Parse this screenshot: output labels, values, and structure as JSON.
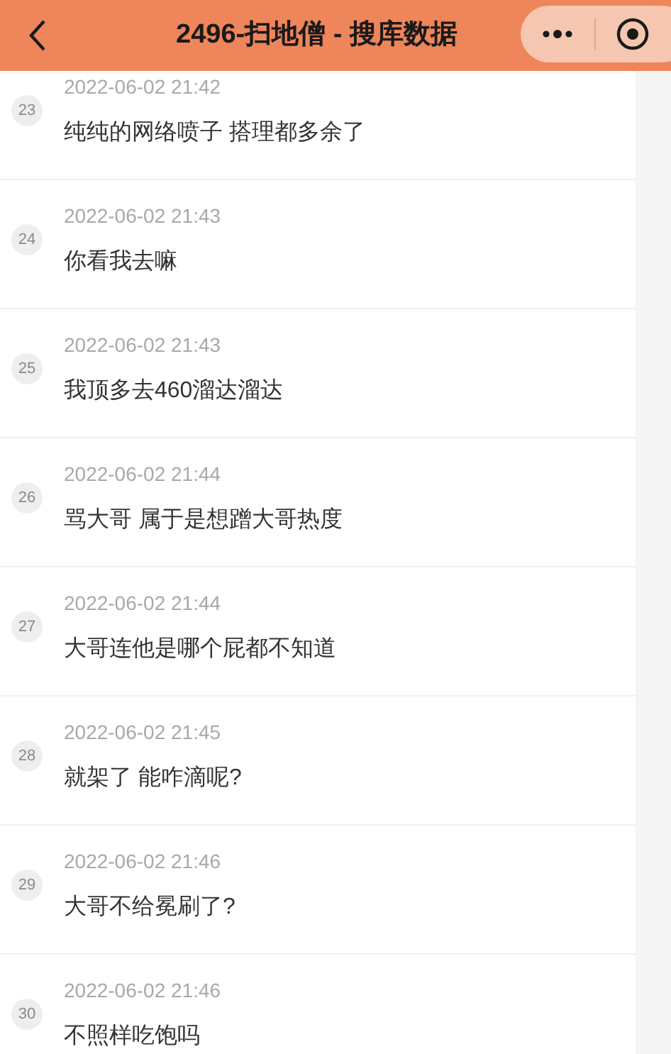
{
  "header": {
    "title": "2496-扫地僧 - 搜库数据"
  },
  "comments": [
    {
      "index": "23",
      "time": "2022-06-02 21:42",
      "text": "纯纯的网络喷子 搭理都多余了"
    },
    {
      "index": "24",
      "time": "2022-06-02 21:43",
      "text": "你看我去嘛"
    },
    {
      "index": "25",
      "time": "2022-06-02 21:43",
      "text": "我顶多去460溜达溜达"
    },
    {
      "index": "26",
      "time": "2022-06-02 21:44",
      "text": "骂大哥 属于是想蹭大哥热度"
    },
    {
      "index": "27",
      "time": "2022-06-02 21:44",
      "text": "大哥连他是哪个屁都不知道"
    },
    {
      "index": "28",
      "time": "2022-06-02 21:45",
      "text": "就架了 能咋滴呢?"
    },
    {
      "index": "29",
      "time": "2022-06-02 21:46",
      "text": "大哥不给冕刷了?"
    },
    {
      "index": "30",
      "time": "2022-06-02 21:46",
      "text": "不照样吃饱吗"
    }
  ]
}
